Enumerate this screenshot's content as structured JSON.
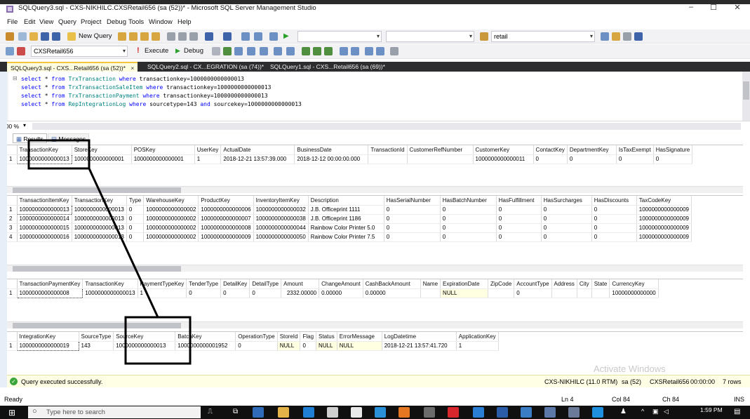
{
  "window": {
    "title": "SQLQuery3.sql - CXS-NIKHILC.CXSRetail656 (sa (52))* - Microsoft SQL Server Management Studio",
    "min": "–",
    "max": "☐",
    "close": "✕"
  },
  "menu": [
    "File",
    "Edit",
    "View",
    "Query",
    "Project",
    "Debug",
    "Tools",
    "Window",
    "Help"
  ],
  "toolbar1": {
    "new_query": "New Query",
    "search_value": "retail"
  },
  "toolbar2": {
    "database": "CXSRetail656",
    "execute": "Execute",
    "debug": "Debug"
  },
  "tabs": [
    {
      "label": "SQLQuery3.sql - CXS...Retail656 (sa (52))*",
      "close": "×"
    },
    {
      "label": "SQLQuery2.sql - CX...EGRATION (sa (74))*"
    },
    {
      "label": "SQLQuery1.sql - CXS...Retail656 (sa (69))*"
    }
  ],
  "editor": {
    "lines": [
      {
        "kw1": "select",
        "star": " * ",
        "kw2": "from",
        "table": "TrxTransaction",
        "kw3": "where",
        "cond": "transactionkey=1000000000000013",
        "kw4": "",
        "cond2": ""
      },
      {
        "kw1": "select",
        "star": " * ",
        "kw2": "from",
        "table": "TrxTransactionSaleItem",
        "kw3": "where",
        "cond": "transactionkey=1000000000000013",
        "kw4": "",
        "cond2": ""
      },
      {
        "kw1": "select",
        "star": " * ",
        "kw2": "from",
        "table": "TrxTransactionPayment",
        "kw3": "where",
        "cond": "transactionkey=1000000000000013",
        "kw4": "",
        "cond2": ""
      },
      {
        "kw1": "select",
        "star": " * ",
        "kw2": "from",
        "table": "RepIntegrationLog",
        "kw3": "where",
        "cond": "sourcetype=143",
        "kw4": "and",
        "cond2": "sourcekey=1000000000000013"
      }
    ]
  },
  "zoom": "100 %",
  "results_tabs": {
    "results": "Results",
    "messages": "Messages"
  },
  "grid1": {
    "columns": [
      "TransactionKey",
      "StoreKey",
      "POSKey",
      "UserKey",
      "ActualDate",
      "BusinessDate",
      "TransactionId",
      "CustomerRefNumber",
      "CustomerKey",
      "ContactKey",
      "DepartmentKey",
      "IsTaxExempt",
      "HasSignature"
    ],
    "rows": [
      [
        "1",
        "1000000000000013",
        "1000000000000001",
        "1000000000000001",
        "1",
        "2018-12-21 13:57:39.000",
        "2018-12-12 00:00:00.000",
        "",
        "",
        "1000000000000011",
        "0",
        "0",
        "0",
        "0"
      ]
    ]
  },
  "grid2": {
    "columns": [
      "TransactionItemKey",
      "TransactionKey",
      "Type",
      "WarehouseKey",
      "ProductKey",
      "InventoryItemKey",
      "Description",
      "HasSerialNumber",
      "HasBatchNumber",
      "HasFulfillment",
      "HasSurcharges",
      "HasDiscounts",
      "TaxCodeKey"
    ],
    "rows": [
      [
        "1",
        "1000000000000013",
        "1000000000000013",
        "0",
        "1000000000000002",
        "1000000000000006",
        "1000000000000032",
        "J.B. Officeprint 1111",
        "0",
        "0",
        "0",
        "0",
        "0",
        "1000000000000009"
      ],
      [
        "2",
        "1000000000000014",
        "1000000000000013",
        "0",
        "1000000000000002",
        "1000000000000007",
        "1000000000000038",
        "J.B. Officeprint 1186",
        "0",
        "0",
        "0",
        "0",
        "0",
        "1000000000000009"
      ],
      [
        "3",
        "1000000000000015",
        "1000000000000013",
        "0",
        "1000000000000002",
        "1000000000000008",
        "1000000000000044",
        "Rainbow Color Printer 5.0",
        "0",
        "0",
        "0",
        "0",
        "0",
        "1000000000000009"
      ],
      [
        "4",
        "1000000000000016",
        "1000000000000013",
        "0",
        "1000000000000002",
        "1000000000000009",
        "1000000000000050",
        "Rainbow Color Printer 7.5",
        "0",
        "0",
        "0",
        "0",
        "0",
        "1000000000000009"
      ]
    ]
  },
  "grid3": {
    "columns": [
      "TransactionPaymentKey",
      "TransactionKey",
      "PaymentTypeKey",
      "TenderType",
      "DetailKey",
      "DetailType",
      "Amount",
      "ChangeAmount",
      "CashBackAmount",
      "Name",
      "ExpirationDate",
      "ZipCode",
      "AccountType",
      "Address",
      "City",
      "State",
      "CurrencyKey"
    ],
    "rows": [
      [
        "1",
        "1000000000000008",
        "1000000000000013",
        "1",
        "0",
        "0",
        "0",
        "2332.00000",
        "0.00000",
        "0.00000",
        "",
        "NULL",
        "",
        "0",
        "",
        "",
        "",
        "10000000000000"
      ]
    ]
  },
  "grid4": {
    "columns": [
      "IntegrationKey",
      "SourceType",
      "SourceKey",
      "BatchKey",
      "OperationType",
      "StoreId",
      "Flag",
      "Status",
      "ErrorMessage",
      "LogDatetime",
      "ApplicationKey"
    ],
    "rows": [
      [
        "1",
        "1000000000000019",
        "143",
        "1000000000000013",
        "1000000000001952",
        "0",
        "NULL",
        "0",
        "NULL",
        "NULL",
        "2018-12-21 13:57:41.720",
        "1"
      ]
    ]
  },
  "watermark": "Activate Windows",
  "query_status": {
    "message": "Query executed successfully.",
    "server": "CXS-NIKHILC (11.0 RTM)",
    "user": "sa (52)",
    "database": "CXSRetail656",
    "elapsed": "00:00:00",
    "rows": "7 rows"
  },
  "app_status": {
    "ready": "Ready",
    "ln": "Ln 4",
    "col": "Col 84",
    "ch": "Ch 84",
    "ins": "INS"
  },
  "taskbar": {
    "search_placeholder": "Type here to search",
    "time": "1:59 PM"
  },
  "colors": {
    "tab_strip": "#2d2d30",
    "active_tab": "#fffde0",
    "keyword": "#0000ff",
    "table_name": "#008080",
    "status_bg": "#ffffe5",
    "success": "#3aa63a"
  }
}
